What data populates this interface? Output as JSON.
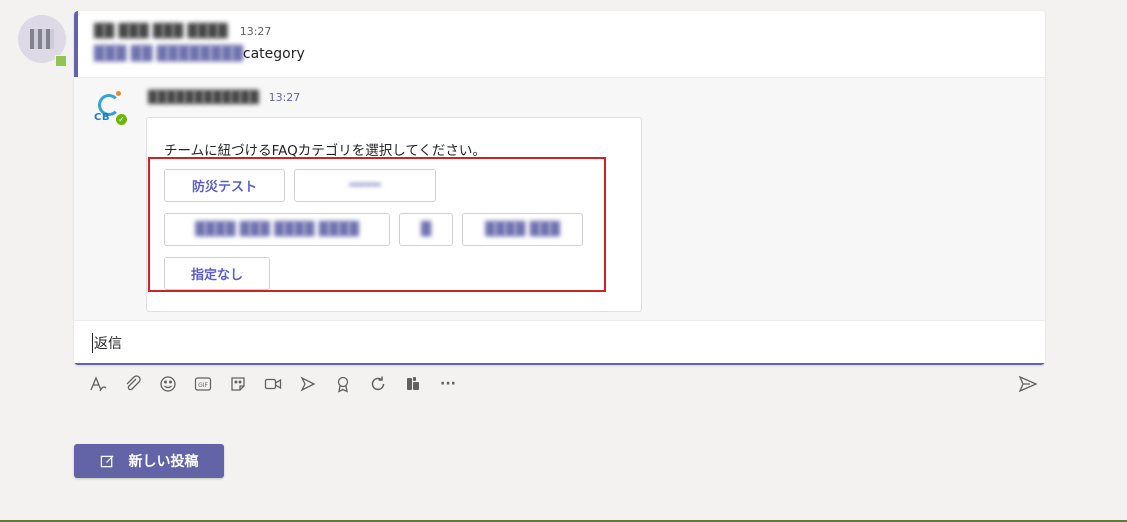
{
  "post": {
    "author": "██ ███ ███ ████",
    "time": "13:27",
    "mention": "███ ██ ████████",
    "body_suffix": "category"
  },
  "bot": {
    "avatar_text": "CB",
    "name": "████████████",
    "time": "13:27"
  },
  "card": {
    "prompt": "チームに紐づけるFAQカテゴリを選択してください。",
    "buttons": [
      {
        "label": "防災テスト",
        "obscured": false
      },
      {
        "label": "━━━━",
        "obscured": true
      },
      {
        "label": "████ ███ ████ ████",
        "obscured": true
      },
      {
        "label": "█",
        "obscured": true
      },
      {
        "label": "████ ███",
        "obscured": true
      },
      {
        "label": "指定なし",
        "obscured": false
      }
    ]
  },
  "compose": {
    "placeholder": "返信"
  },
  "toolbar": {
    "icons": [
      "format-icon",
      "attach-icon",
      "emoji-icon",
      "gif-icon",
      "sticker-icon",
      "meet-icon",
      "stream-icon",
      "praise-icon",
      "loop-icon",
      "apps-icon",
      "more-icon"
    ],
    "gif_label": "GIF",
    "more_label": "···"
  },
  "new_post": {
    "label": "新しい投稿"
  },
  "colors": {
    "accent": "#6264a7",
    "highlight": "#d0212b",
    "presence": "#92c353"
  }
}
